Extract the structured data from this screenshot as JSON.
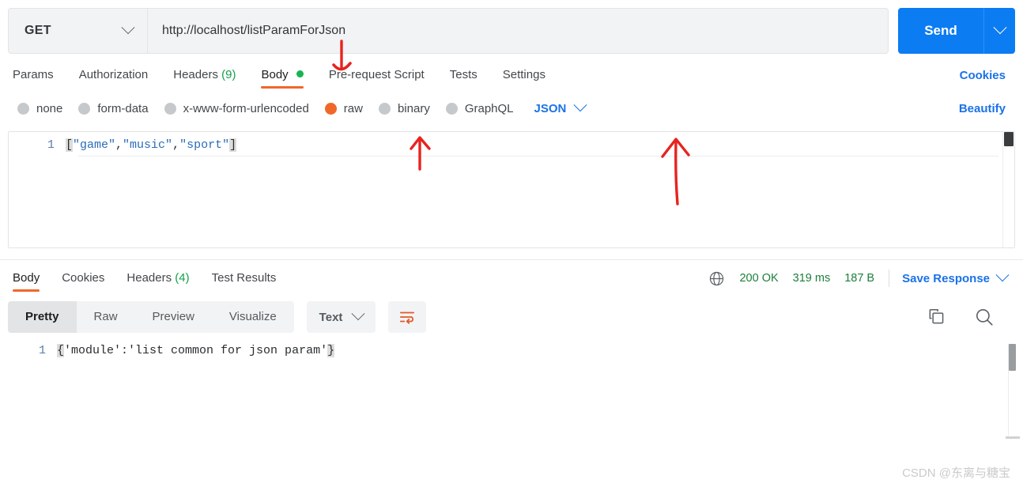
{
  "request": {
    "method": "GET",
    "url": "http://localhost/listParamForJson",
    "send_label": "Send",
    "tabs": [
      {
        "label": "Params",
        "active": false
      },
      {
        "label": "Authorization",
        "active": false
      },
      {
        "label": "Headers",
        "count": "(9)",
        "active": false
      },
      {
        "label": "Body",
        "active": true,
        "dot": true
      },
      {
        "label": "Pre-request Script",
        "active": false
      },
      {
        "label": "Tests",
        "active": false
      },
      {
        "label": "Settings",
        "active": false
      }
    ],
    "cookies_link": "Cookies",
    "body_options": [
      {
        "label": "none",
        "selected": false
      },
      {
        "label": "form-data",
        "selected": false
      },
      {
        "label": "x-www-form-urlencoded",
        "selected": false
      },
      {
        "label": "raw",
        "selected": true
      },
      {
        "label": "binary",
        "selected": false
      },
      {
        "label": "GraphQL",
        "selected": false
      }
    ],
    "raw_format": "JSON",
    "beautify_label": "Beautify",
    "editor": {
      "line_number": "1",
      "open_bracket": "[",
      "str1": "\"game\"",
      "comma1": ",",
      "str2": "\"music\"",
      "comma2": ",",
      "str3": "\"sport\"",
      "close_bracket": "]"
    }
  },
  "response": {
    "tabs": [
      {
        "label": "Body",
        "active": true
      },
      {
        "label": "Cookies",
        "active": false
      },
      {
        "label": "Headers",
        "count": "(4)",
        "active": false
      },
      {
        "label": "Test Results",
        "active": false
      }
    ],
    "status": "200 OK",
    "time": "319 ms",
    "size": "187 B",
    "save_response": "Save Response",
    "view_modes": [
      {
        "label": "Pretty",
        "active": true
      },
      {
        "label": "Raw",
        "active": false
      },
      {
        "label": "Preview",
        "active": false
      },
      {
        "label": "Visualize",
        "active": false
      }
    ],
    "format": "Text",
    "body": {
      "line_number": "1",
      "open_brace": "{",
      "content": "'module':'list common for json param'",
      "close_brace": "}"
    }
  },
  "watermark": "CSDN @东离与糖宝",
  "colors": {
    "accent_orange": "#f0672a",
    "link_blue": "#1a72e8",
    "send_blue": "#0c7cf2",
    "status_green": "#1b7f3b",
    "annotation_red": "#e8231f"
  }
}
